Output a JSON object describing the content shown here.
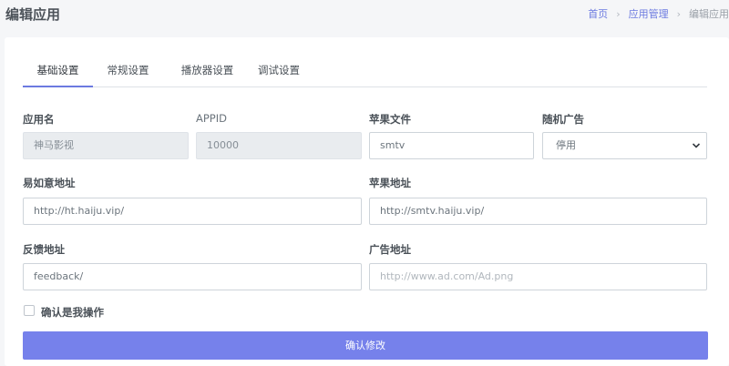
{
  "header": {
    "title": "编辑应用",
    "breadcrumb": {
      "home": "首页",
      "section": "应用管理",
      "current": "编辑应用"
    }
  },
  "tabs": [
    "基础设置",
    "常规设置",
    "播放器设置",
    "调试设置"
  ],
  "active_tab": "基础设置",
  "form": {
    "app_name": {
      "label": "应用名",
      "value": "神马影视"
    },
    "appid": {
      "label": "APPID",
      "value": "10000"
    },
    "apple_file": {
      "label": "苹果文件",
      "value": "smtv"
    },
    "random_ad": {
      "label": "随机广告",
      "value": "停用"
    },
    "easy_pay_url": {
      "label": "易如意地址",
      "value": "http://ht.haiju.vip/"
    },
    "apple_url": {
      "label": "苹果地址",
      "value": "http://smtv.haiju.vip/"
    },
    "feedback_url": {
      "label": "反馈地址",
      "value": "feedback/"
    },
    "ad_url": {
      "label": "广告地址",
      "placeholder": "http://www.ad.com/Ad.png"
    },
    "confirm_label": "确认是我操作",
    "submit_label": "确认修改"
  },
  "colors": {
    "accent": "#6c7ae0",
    "button": "#7681eb",
    "background": "#f5f6f8"
  }
}
